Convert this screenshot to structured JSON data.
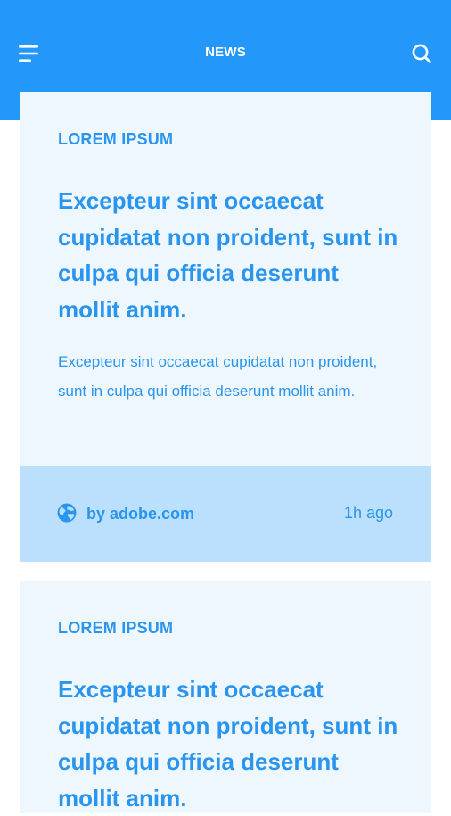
{
  "header": {
    "title": "NEWS",
    "menu_icon": "hamburger-menu-icon",
    "search_icon": "search-icon",
    "background_color": "#2497fb"
  },
  "cards": [
    {
      "category": "LOREM IPSUM",
      "title": "Excepteur sint occaecat cupidatat non proident, sunt in culpa qui officia deserunt mollit anim.",
      "body": "Excepteur sint occaecat cupidatat non proident, sunt in culpa qui officia deserunt mollit anim.",
      "source": "by adobe.com",
      "source_icon": "globe-icon",
      "time": "1h ago"
    },
    {
      "category": "LOREM IPSUM",
      "title": "Excepteur sint occaecat cupidatat non proident, sunt in culpa qui officia deserunt mollit anim."
    }
  ],
  "colors": {
    "accent_text": "#2a95ee",
    "card_background": "#eef7fe",
    "footer_background": "#bae0fd"
  }
}
